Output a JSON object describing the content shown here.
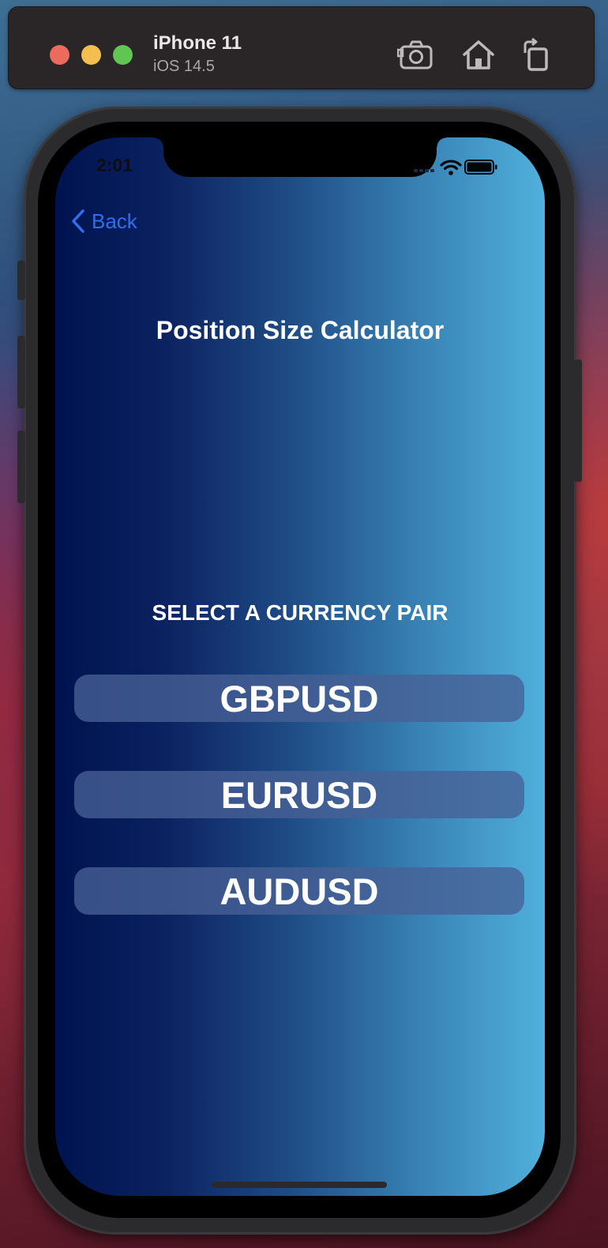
{
  "simulator": {
    "device_name": "iPhone 11",
    "os_version": "iOS 14.5",
    "icons": [
      "screenshot-icon",
      "home-icon",
      "rotate-icon"
    ]
  },
  "status_bar": {
    "time": "2:01",
    "icons": [
      "signal-icon",
      "wifi-icon",
      "battery-icon"
    ]
  },
  "nav": {
    "back_label": "Back"
  },
  "screen": {
    "title": "Position Size Calculator",
    "prompt": "SELECT A CURRENCY PAIR",
    "pairs": [
      "GBPUSD",
      "EURUSD",
      "AUDUSD"
    ]
  },
  "colors": {
    "accent_link": "#2f6fea",
    "gradient_left": "#001350",
    "gradient_right": "#50b0dc",
    "button_fill": "#48609688"
  }
}
